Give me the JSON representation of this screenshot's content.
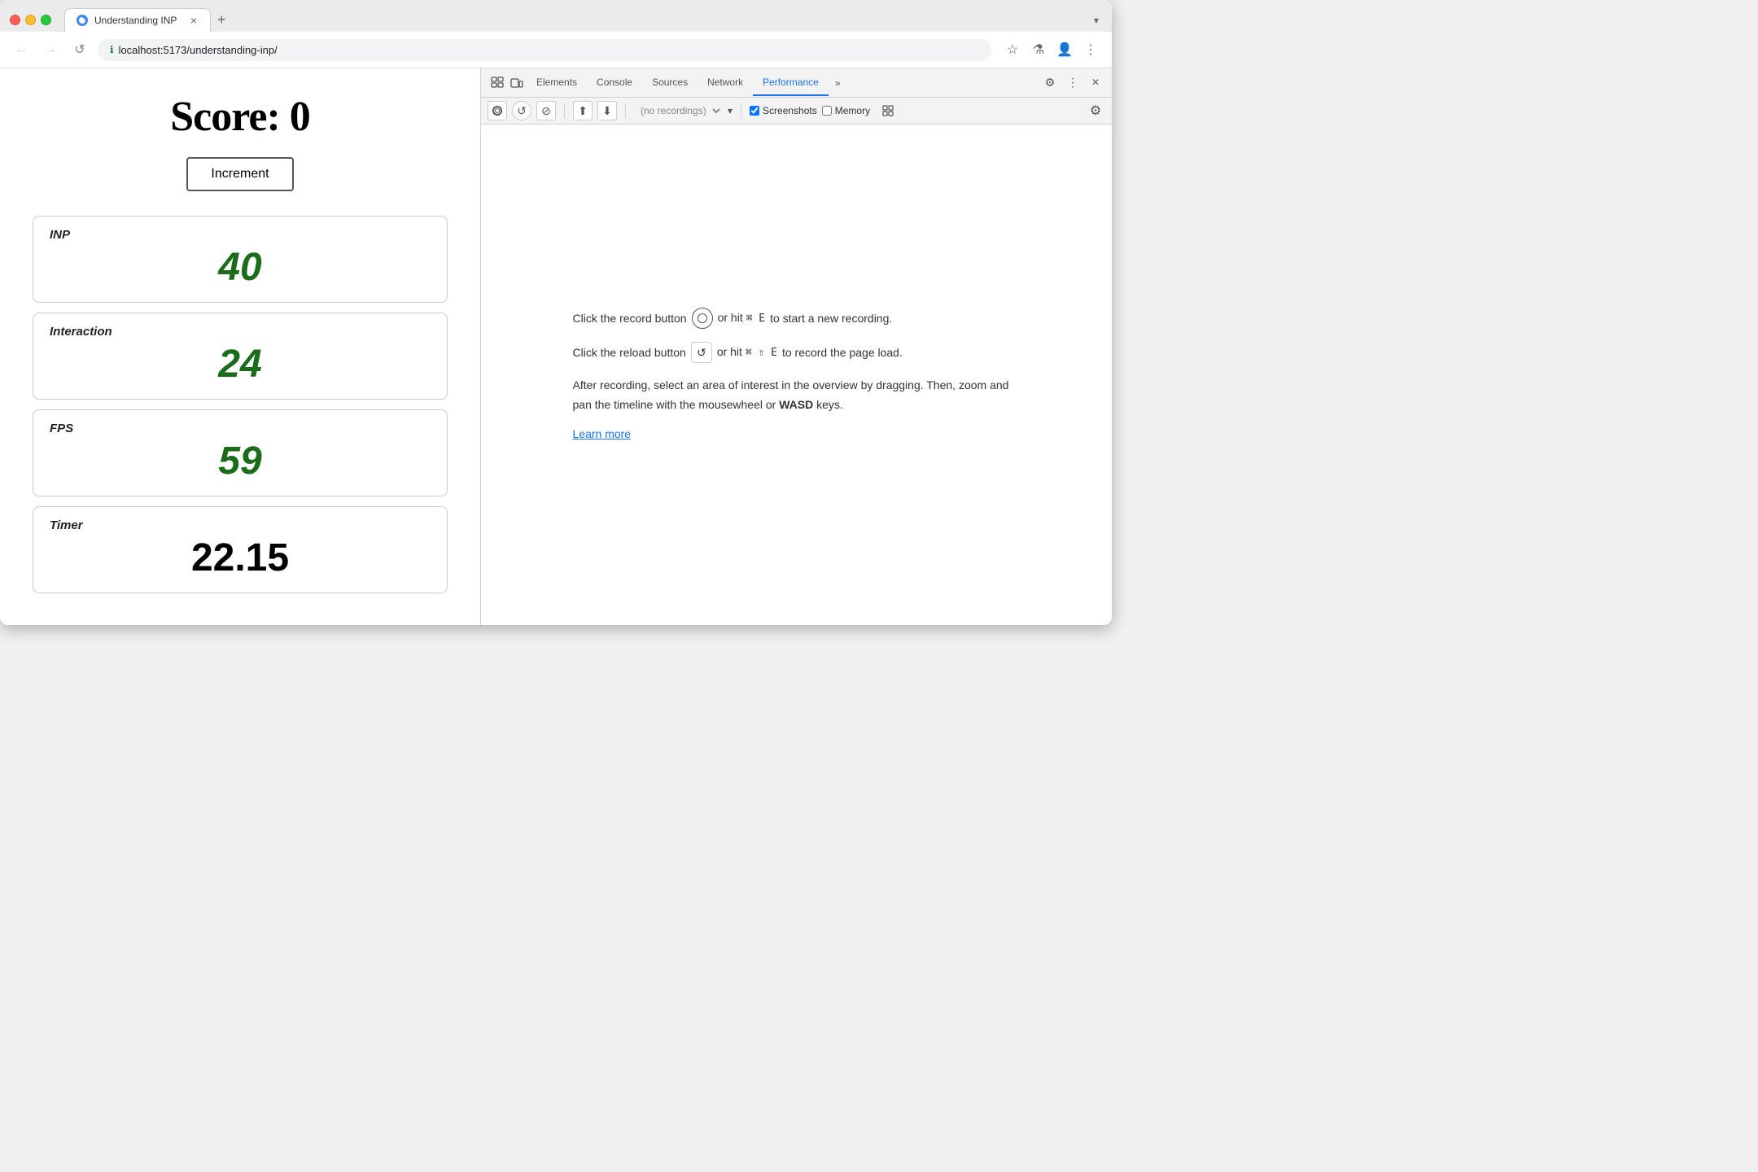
{
  "browser": {
    "traffic_lights": [
      "close",
      "minimize",
      "maximize"
    ],
    "tab": {
      "favicon": "🌐",
      "title": "Understanding INP",
      "close_label": "×"
    },
    "new_tab_label": "+",
    "tab_chevron": "▾",
    "address": {
      "secure_icon": "ℹ",
      "url": "localhost:5173/understanding-inp/"
    },
    "toolbar": {
      "back": "←",
      "forward": "→",
      "refresh": "↺",
      "bookmark": "☆",
      "experiments": "⚗",
      "profile": "👤",
      "more": "⋮"
    }
  },
  "webpage": {
    "score_label": "Score:",
    "score_value": "0",
    "increment_button": "Increment",
    "metrics": [
      {
        "label": "INP",
        "value": "40",
        "type": "number"
      },
      {
        "label": "Interaction",
        "value": "24",
        "type": "number"
      },
      {
        "label": "FPS",
        "value": "59",
        "type": "number"
      },
      {
        "label": "Timer",
        "value": "22.15",
        "type": "timer"
      }
    ]
  },
  "devtools": {
    "tabs": [
      "Elements",
      "Console",
      "Sources",
      "Network",
      "Performance"
    ],
    "active_tab": "Performance",
    "more_tabs": "»",
    "icons": {
      "settings": "⚙",
      "more": "⋮",
      "close": "×"
    },
    "toolbar2": {
      "record_icon": "⏺",
      "reload_icon": "↺",
      "clear_icon": "⊘",
      "upload_icon": "⬆",
      "download_icon": "⬇",
      "recordings_placeholder": "(no recordings)",
      "screenshots_label": "Screenshots",
      "memory_label": "Memory",
      "settings_icon": "⚙"
    },
    "content": {
      "record_instruction": "Click the record button",
      "record_shortcut": "⌘ E",
      "record_suffix": "to start a new recording.",
      "reload_instruction": "Click the reload button",
      "reload_shortcut": "⌘ ⇧ E",
      "reload_suffix": "to record the page load.",
      "description": "After recording, select an area of interest in the overview by dragging. Then, zoom and pan the timeline with the mousewheel or",
      "description_bold": "WASD",
      "description_suffix": "keys.",
      "learn_more": "Learn more"
    }
  }
}
